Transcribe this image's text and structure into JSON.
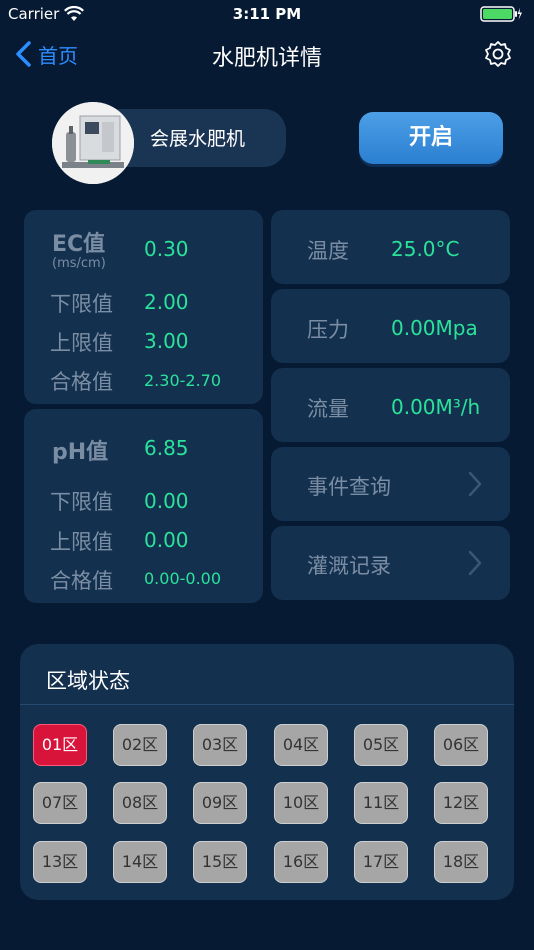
{
  "status_bar": {
    "carrier": "Carrier",
    "time": "3:11 PM"
  },
  "nav": {
    "back_label": "首页",
    "title": "水肥机详情"
  },
  "device": {
    "name": "会展水肥机",
    "start_label": "开启"
  },
  "ec": {
    "label": "EC值",
    "unit": "(ms/cm)",
    "value": "0.30",
    "lower_label": "下限值",
    "lower": "2.00",
    "upper_label": "上限值",
    "upper": "3.00",
    "range_label": "合格值",
    "range": "2.30-2.70"
  },
  "ph": {
    "label": "pH值",
    "value": "6.85",
    "lower_label": "下限值",
    "lower": "0.00",
    "upper_label": "上限值",
    "upper": "0.00",
    "range_label": "合格值",
    "range": "0.00-0.00"
  },
  "info": {
    "temperature_label": "温度",
    "temperature": "25.0°C",
    "pressure_label": "压力",
    "pressure": "0.00Mpa",
    "flow_label": "流量",
    "flow": "0.00M³/h",
    "events_label": "事件查询",
    "irrigation_label": "灌溉记录"
  },
  "zones": {
    "title": "区域状态",
    "items": [
      {
        "label": "01区",
        "active": true
      },
      {
        "label": "02区",
        "active": false
      },
      {
        "label": "03区",
        "active": false
      },
      {
        "label": "04区",
        "active": false
      },
      {
        "label": "05区",
        "active": false
      },
      {
        "label": "06区",
        "active": false
      },
      {
        "label": "07区",
        "active": false
      },
      {
        "label": "08区",
        "active": false
      },
      {
        "label": "09区",
        "active": false
      },
      {
        "label": "10区",
        "active": false
      },
      {
        "label": "11区",
        "active": false
      },
      {
        "label": "12区",
        "active": false
      },
      {
        "label": "13区",
        "active": false
      },
      {
        "label": "14区",
        "active": false
      },
      {
        "label": "15区",
        "active": false
      },
      {
        "label": "16区",
        "active": false
      },
      {
        "label": "17区",
        "active": false
      },
      {
        "label": "18区",
        "active": false
      }
    ]
  },
  "colors": {
    "background": "#061a33",
    "panel": "#13304f",
    "value_green": "#2be29a",
    "accent_blue": "#2c8dff",
    "active_zone": "#d9143a"
  }
}
